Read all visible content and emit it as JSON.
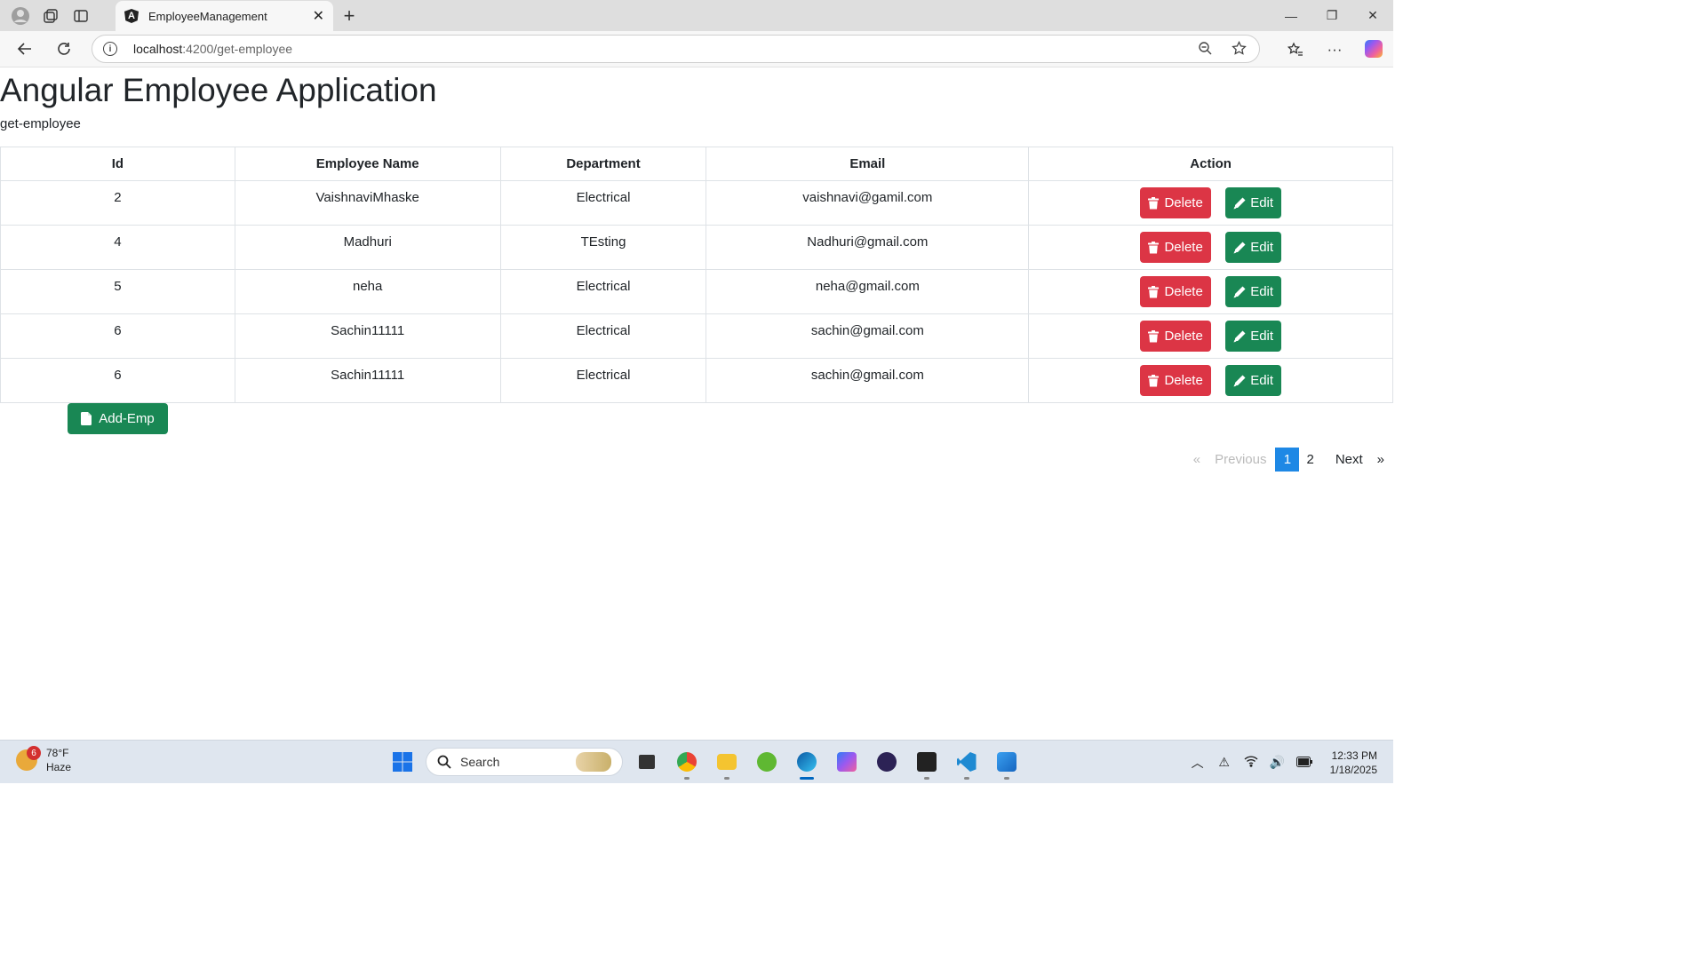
{
  "browser": {
    "tab_title": "EmployeeManagement",
    "favicon_letter": "A",
    "url_host": "localhost",
    "url_path": ":4200/get-employee"
  },
  "page": {
    "title": "Angular Employee Application",
    "subtitle": "get-employee"
  },
  "table": {
    "headers": [
      "Id",
      "Employee Name",
      "Department",
      "Email",
      "Action"
    ],
    "rows": [
      {
        "id": "2",
        "name": "VaishnaviMhaske",
        "department": "Electrical",
        "email": "vaishnavi@gamil.com"
      },
      {
        "id": "4",
        "name": "Madhuri",
        "department": "TEsting",
        "email": "Nadhuri@gmail.com"
      },
      {
        "id": "5",
        "name": "neha",
        "department": "Electrical",
        "email": "neha@gmail.com"
      },
      {
        "id": "6",
        "name": "Sachin11111",
        "department": "Electrical",
        "email": "sachin@gmail.com"
      },
      {
        "id": "6",
        "name": "Sachin11111",
        "department": "Electrical",
        "email": "sachin@gmail.com"
      }
    ],
    "delete_label": "Delete",
    "edit_label": "Edit"
  },
  "add_button": {
    "label": "Add-Emp"
  },
  "pagination": {
    "first": "«",
    "previous": "Previous",
    "pages": [
      "1",
      "2"
    ],
    "current": "1",
    "next": "Next",
    "last": "»"
  },
  "taskbar": {
    "weather_temp": "78°F",
    "weather_desc": "Haze",
    "weather_badge": "6",
    "search_label": "Search",
    "time": "12:33 PM",
    "date": "1/18/2025"
  },
  "colors": {
    "delete": "#dc3545",
    "edit": "#198754",
    "page_active": "#1e88e5"
  }
}
